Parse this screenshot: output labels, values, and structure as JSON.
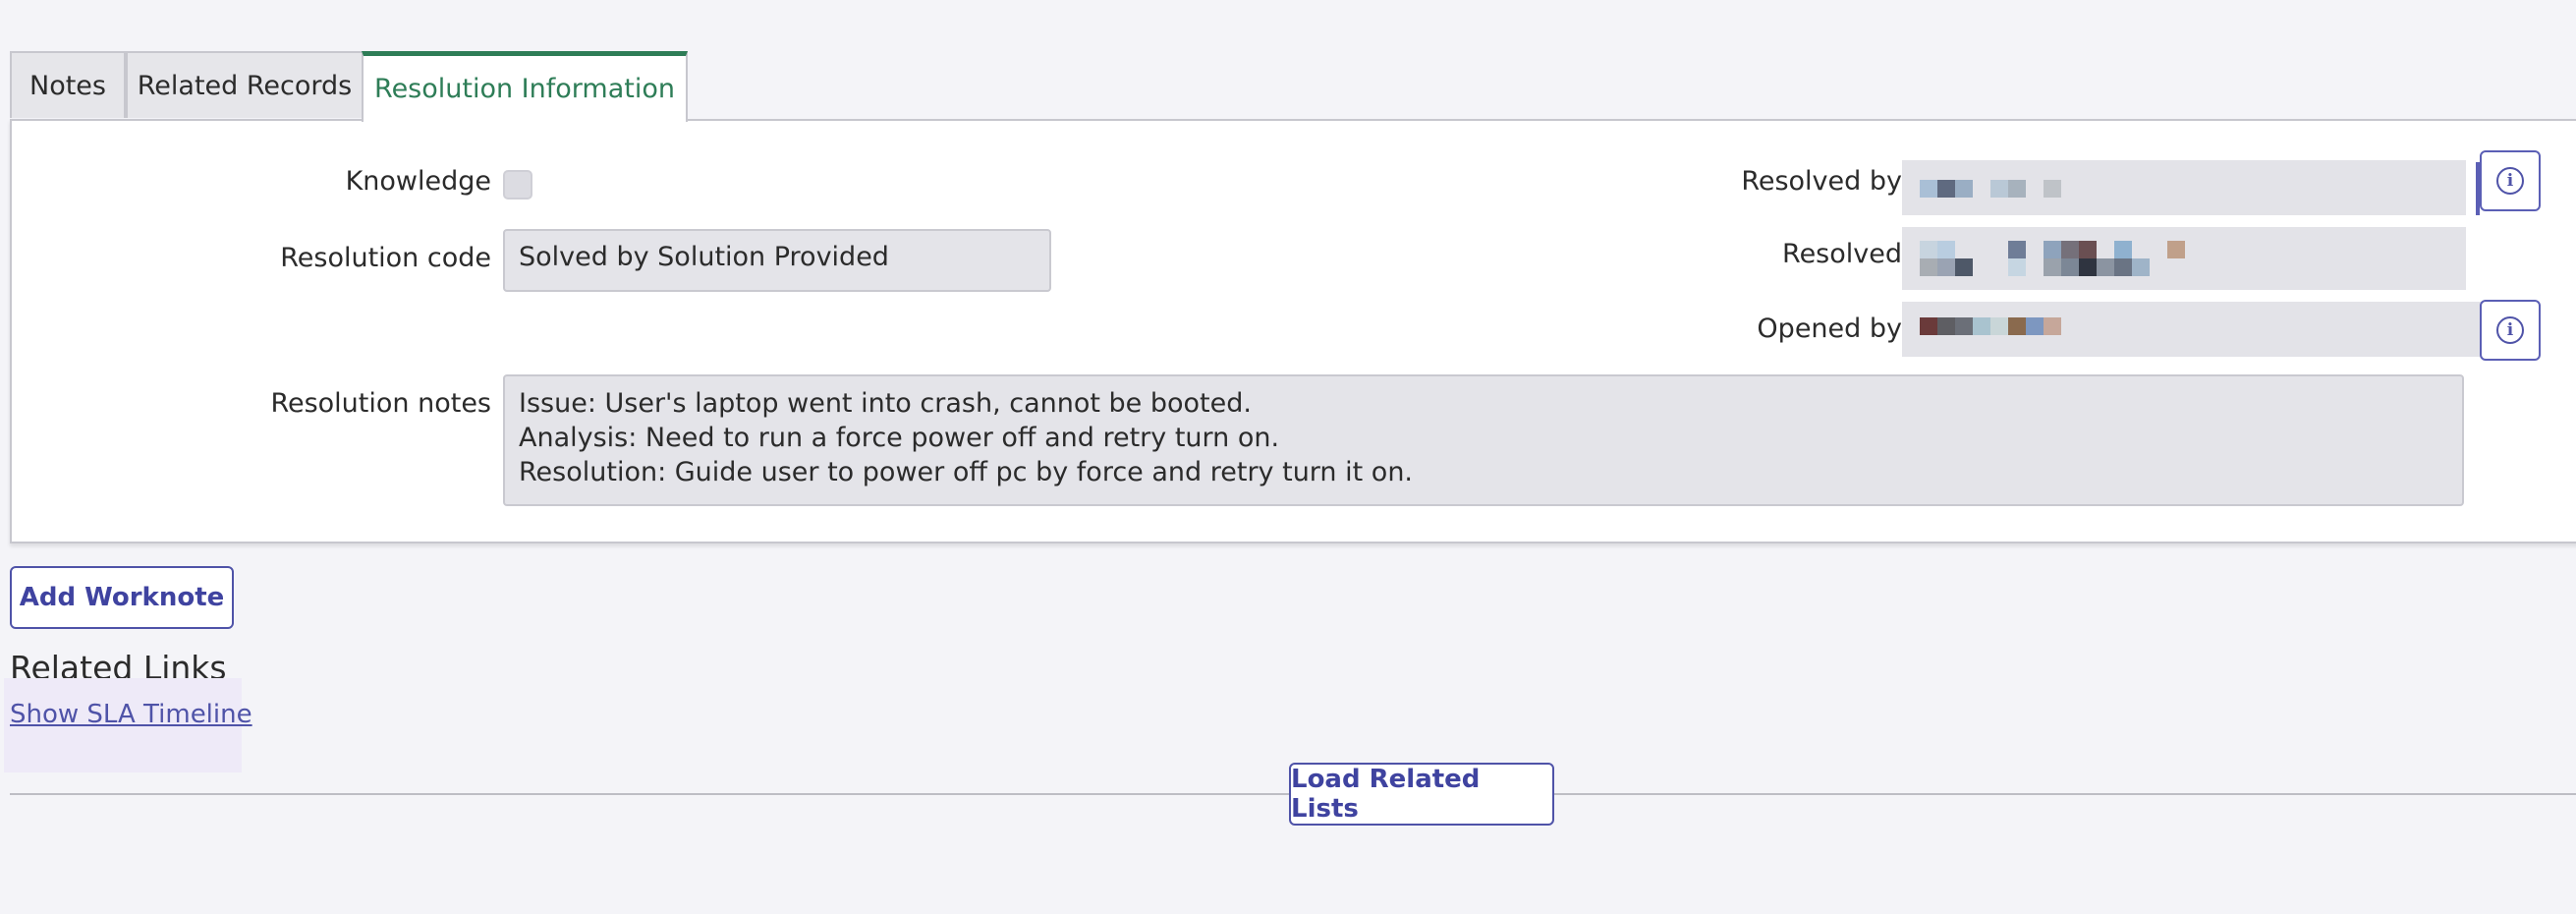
{
  "tabs": {
    "notes": "Notes",
    "related_records": "Related Records",
    "resolution_information": "Resolution Information",
    "active": "Resolution Information"
  },
  "form": {
    "knowledge_label": "Knowledge",
    "knowledge_checked": false,
    "resolution_code_label": "Resolution code",
    "resolution_code_value": "Solved by Solution Provided",
    "resolution_notes_label": "Resolution notes",
    "resolution_notes_lines": [
      "Issue: User's laptop went into crash, cannot be booted.",
      "Analysis: Need to run a force power off and retry turn on.",
      "Resolution: Guide user to power off pc by force and retry turn it on."
    ],
    "resolved_by_label": "Resolved by",
    "resolved_label": "Resolved",
    "opened_by_label": "Opened by"
  },
  "icons": {
    "info": "info-icon"
  },
  "actions": {
    "add_worknote": "Add Worknote",
    "load_related_lists": "Load Related Lists"
  },
  "related_links": {
    "title": "Related Links",
    "show_sla_timeline": "Show SLA Timeline"
  },
  "colors": {
    "accent_green": "#2e7d57",
    "accent_indigo": "#4f53a8"
  }
}
